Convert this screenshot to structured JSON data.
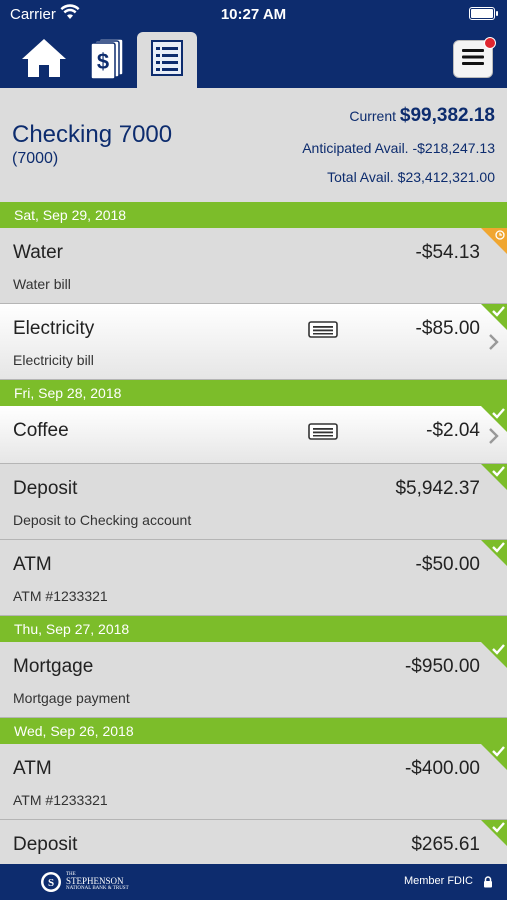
{
  "status": {
    "carrier": "Carrier",
    "time": "10:27 AM"
  },
  "nav": {
    "tabs": [
      {
        "name": "home",
        "icon": "home-icon"
      },
      {
        "name": "transfers",
        "icon": "dollar-docs-icon"
      },
      {
        "name": "register",
        "icon": "register-icon",
        "active": true
      }
    ],
    "menu_icon": "hamburger-menu-icon",
    "has_notification": true
  },
  "account": {
    "name": "Checking 7000",
    "number": "(7000)",
    "current_label": "Current",
    "current_value": "$99,382.18",
    "anticipated_label": "Anticipated Avail.",
    "anticipated_value": "-$218,247.13",
    "total_label": "Total Avail.",
    "total_value": "$23,412,321.00"
  },
  "days": [
    {
      "date": "Sat, Sep 29, 2018",
      "transactions": [
        {
          "name": "Water",
          "desc": "Water bill",
          "amount": "-$54.13",
          "status": "pending"
        },
        {
          "name": "Electricity",
          "desc": "Electricity bill",
          "amount": "-$85.00",
          "status": "cleared",
          "memo": true,
          "selected": true
        }
      ]
    },
    {
      "date": "Fri, Sep 28, 2018",
      "transactions": [
        {
          "name": "Coffee",
          "desc": "",
          "amount": "-$2.04",
          "status": "cleared",
          "memo": true,
          "selected": true,
          "short": true
        },
        {
          "name": "Deposit",
          "desc": "Deposit to Checking account",
          "amount": "$5,942.37",
          "status": "cleared"
        },
        {
          "name": "ATM",
          "desc": "ATM #1233321",
          "amount": "-$50.00",
          "status": "cleared"
        }
      ]
    },
    {
      "date": "Thu, Sep 27, 2018",
      "transactions": [
        {
          "name": "Mortgage",
          "desc": "Mortgage payment",
          "amount": "-$950.00",
          "status": "cleared"
        }
      ]
    },
    {
      "date": "Wed, Sep 26, 2018",
      "transactions": [
        {
          "name": "ATM",
          "desc": "ATM #1233321",
          "amount": "-$400.00",
          "status": "cleared"
        },
        {
          "name": "Deposit",
          "desc": "",
          "amount": "$265.61",
          "status": "cleared"
        }
      ]
    }
  ],
  "footer": {
    "logo_text": [
      "THE",
      "STEPHENSON",
      "NATIONAL BANK & TRUST"
    ],
    "fdic": "Member FDIC",
    "lock_icon": "lock-icon"
  },
  "colors": {
    "navy": "#0d2c6e",
    "green": "#7cbd2a",
    "pending": "#f0a630",
    "background": "#dcdcdc"
  }
}
